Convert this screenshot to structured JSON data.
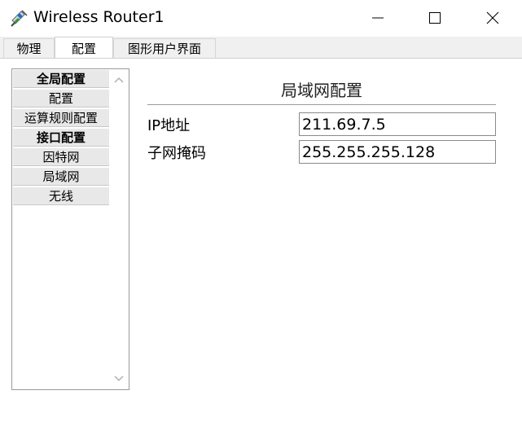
{
  "window": {
    "title": "Wireless Router1",
    "icon": "router-icon"
  },
  "tabs": [
    {
      "label": "物理",
      "active": false
    },
    {
      "label": "配置",
      "active": true
    },
    {
      "label": "图形用户界面",
      "active": false
    }
  ],
  "sidebar": {
    "items": [
      {
        "label": "全局配置",
        "header": true
      },
      {
        "label": "配置",
        "header": false
      },
      {
        "label": "运算规则配置",
        "header": false
      },
      {
        "label": "接口配置",
        "header": true
      },
      {
        "label": "因特网",
        "header": false
      },
      {
        "label": "局域网",
        "header": false
      },
      {
        "label": "无线",
        "header": false
      }
    ]
  },
  "panel": {
    "title": "局域网配置",
    "ip_label": "IP地址",
    "ip_value": "211.69.7.5",
    "subnet_label": "子网掩码",
    "subnet_value": "255.255.255.128"
  }
}
